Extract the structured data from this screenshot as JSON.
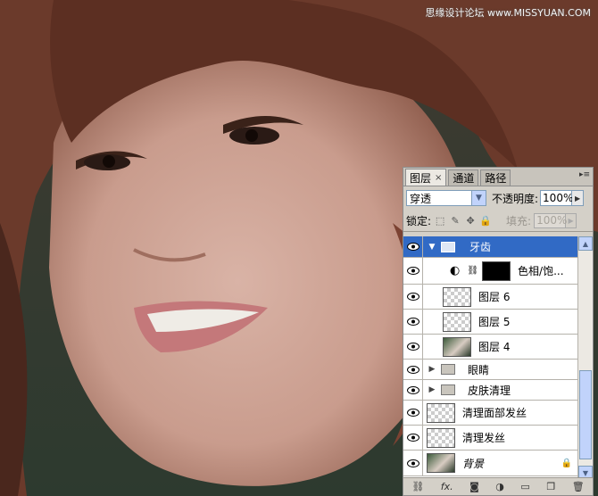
{
  "watermark": "思缘设计论坛 www.MISSYUAN.COM",
  "panel": {
    "tabs": [
      {
        "label": "图层",
        "close": "×"
      },
      {
        "label": "通道"
      },
      {
        "label": "路径"
      }
    ],
    "blend_mode": "穿透",
    "opacity_label": "不透明度:",
    "opacity_value": "100%",
    "lock_label": "锁定:",
    "fill_label": "填充:",
    "fill_value": "100%",
    "layers": [
      {
        "name": "牙齿",
        "type": "group",
        "selected": true
      },
      {
        "name": "色相/饱...",
        "type": "adjustment"
      },
      {
        "name": "图层 6",
        "type": "transparent"
      },
      {
        "name": "图层 5",
        "type": "transparent"
      },
      {
        "name": "图层 4",
        "type": "image"
      },
      {
        "name": "眼睛",
        "type": "group"
      },
      {
        "name": "皮肤清理",
        "type": "group"
      },
      {
        "name": "清理面部发丝",
        "type": "transparent"
      },
      {
        "name": "清理发丝",
        "type": "transparent"
      },
      {
        "name": "背景",
        "type": "background"
      }
    ],
    "footer_icons": [
      "link-icon",
      "fx-icon",
      "mask-icon",
      "adjustment-icon",
      "group-icon",
      "new-layer-icon",
      "trash-icon"
    ],
    "footer_fx": "fx."
  }
}
